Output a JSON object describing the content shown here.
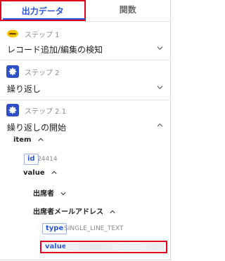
{
  "tabs": {
    "output_data": "出力データ",
    "functions": "関数"
  },
  "steps": [
    {
      "label": "ステップ 1",
      "title": "レコード追加/編集の検知",
      "icon": "kintone-icon"
    },
    {
      "label": "ステップ 2",
      "title": "繰り返し",
      "icon": "gear-icon"
    },
    {
      "label": "ステップ 2.1",
      "title": "繰り返しの開始",
      "icon": "gear-icon"
    }
  ],
  "tree": {
    "item": "item",
    "id_badge": "id",
    "id_value": "24414",
    "value": "value",
    "attendee": "出席者",
    "attendee_email": "出席者メールアドレス",
    "type_badge": "type",
    "type_value": "SINGLE_LINE_TEXT",
    "value_badge": "value"
  },
  "colors": {
    "accent": "#2b55d8",
    "highlight": "#e0001b",
    "gear_bg": "#2f4fc5"
  }
}
